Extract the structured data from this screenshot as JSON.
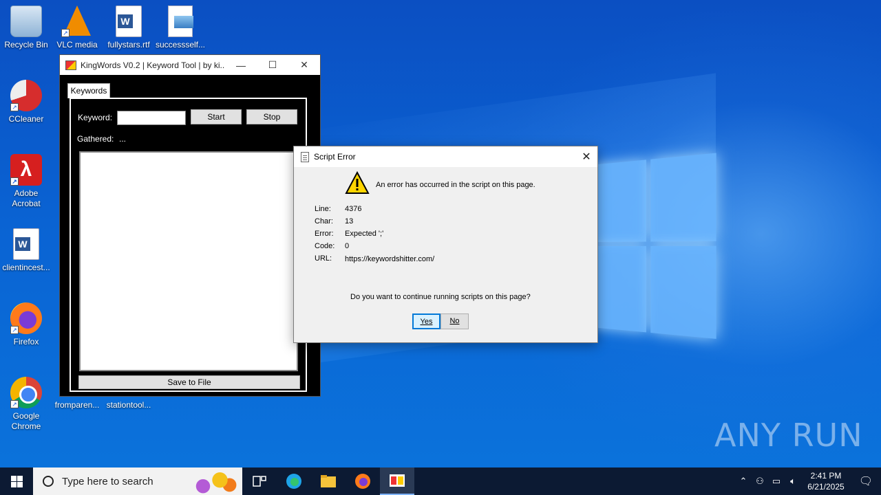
{
  "desktop": {
    "icons": [
      {
        "label": "Recycle Bin",
        "icon": "recycle-bin-icon"
      },
      {
        "label": "VLC media",
        "icon": "vlc-icon"
      },
      {
        "label": "fullystars.rtf",
        "icon": "word-document-icon"
      },
      {
        "label": "successself...",
        "icon": "image-file-icon"
      },
      {
        "label": "CCleaner",
        "icon": "ccleaner-icon"
      },
      {
        "label": "Adobe Acrobat",
        "icon": "acrobat-icon"
      },
      {
        "label": "clientincest...",
        "icon": "word-document-icon"
      },
      {
        "label": "Firefox",
        "icon": "firefox-icon"
      },
      {
        "label": "Google Chrome",
        "icon": "chrome-icon"
      },
      {
        "label": "fromparen...",
        "icon": "document-icon"
      },
      {
        "label": "stationtool...",
        "icon": "word-document-icon"
      }
    ]
  },
  "kingwords": {
    "title": "KingWords V0.2 | Keyword Tool | by ki...",
    "tab": "Keywords",
    "keyword_label": "Keyword:",
    "keyword_value": "",
    "start_label": "Start",
    "stop_label": "Stop",
    "gathered_label": "Gathered:",
    "gathered_value": "...",
    "save_label": "Save to File"
  },
  "dialog": {
    "title": "Script Error",
    "message": "An error has occurred in the script on this page.",
    "fields": [
      {
        "label": "Line:",
        "value": "4376"
      },
      {
        "label": "Char:",
        "value": "13"
      },
      {
        "label": "Error:",
        "value": "Expected ';'"
      },
      {
        "label": "Code:",
        "value": "0"
      },
      {
        "label": "URL:",
        "value": "https://keywordshitter.com/"
      }
    ],
    "question": "Do you want to continue running scripts on this page?",
    "yes_label": "Yes",
    "no_label": "No"
  },
  "watermark": "ANY RUN",
  "taskbar": {
    "search_placeholder": "Type here to search",
    "time": "2:41 PM",
    "date": "6/21/2025"
  },
  "colors": {
    "desktop_blue": "#0a63d3",
    "taskbar": "#0c1a33",
    "dialog_bg": "#f0f0f0",
    "accent": "#0078d7"
  }
}
